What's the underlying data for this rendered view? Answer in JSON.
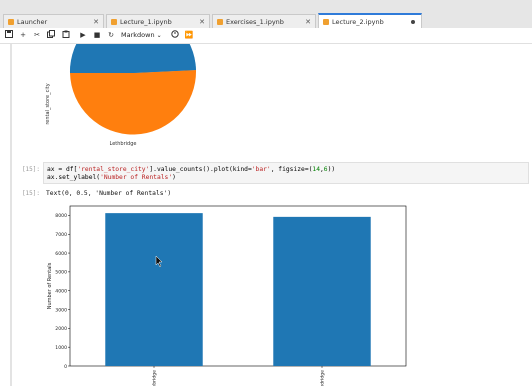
{
  "tabs": [
    {
      "label": "Launcher",
      "icon": "launcher-icon",
      "active": false
    },
    {
      "label": "Lecture_1.ipynb",
      "icon": "notebook-icon",
      "active": false
    },
    {
      "label": "Exercises_1.ipynb",
      "icon": "notebook-icon",
      "active": false
    },
    {
      "label": "Lecture_2.ipynb",
      "icon": "notebook-icon",
      "active": true
    }
  ],
  "toolbar": {
    "cell_type": "Markdown",
    "icons": [
      "save-icon",
      "add-cell-icon",
      "cut-icon",
      "copy-icon",
      "paste-icon",
      "run-icon",
      "stop-icon",
      "restart-icon",
      "fast-forward-icon"
    ]
  },
  "pie_output": {
    "ylabel": "rental_store_city",
    "slice_label": "Lethbridge",
    "colors": {
      "slice_1": "#1f77b4",
      "slice_2": "#ff7f0e"
    }
  },
  "cell": {
    "prompt": "[15]:",
    "code_line_1": {
      "a": "ax = df[",
      "b": "'rental_store_city'",
      "c": "].value_counts().plot(kind=",
      "d": "'bar'",
      "e": ", figsize=(",
      "f": "14",
      "g": ",",
      "h": "6",
      "i": "))"
    },
    "code_line_2": {
      "a": "ax.set_ylabel(",
      "b": "'Number of Rentals'",
      "c": ")"
    },
    "output_prompt": "[15]:",
    "output_text": "Text(0, 0.5, 'Number of Rentals')"
  },
  "chart_data": {
    "type": "bar",
    "categories": [
      "Lethbridge",
      "Woodridge"
    ],
    "visible_tick_labels": [
      "...bridge",
      "...oodridge"
    ],
    "values": [
      8121,
      7923
    ],
    "ylabel": "Number of Rentals",
    "yticks": [
      0,
      1000,
      2000,
      3000,
      4000,
      5000,
      6000,
      7000,
      8000
    ],
    "ylim": [
      0,
      8500
    ],
    "bar_color": "#1f77b4",
    "grid": false
  }
}
